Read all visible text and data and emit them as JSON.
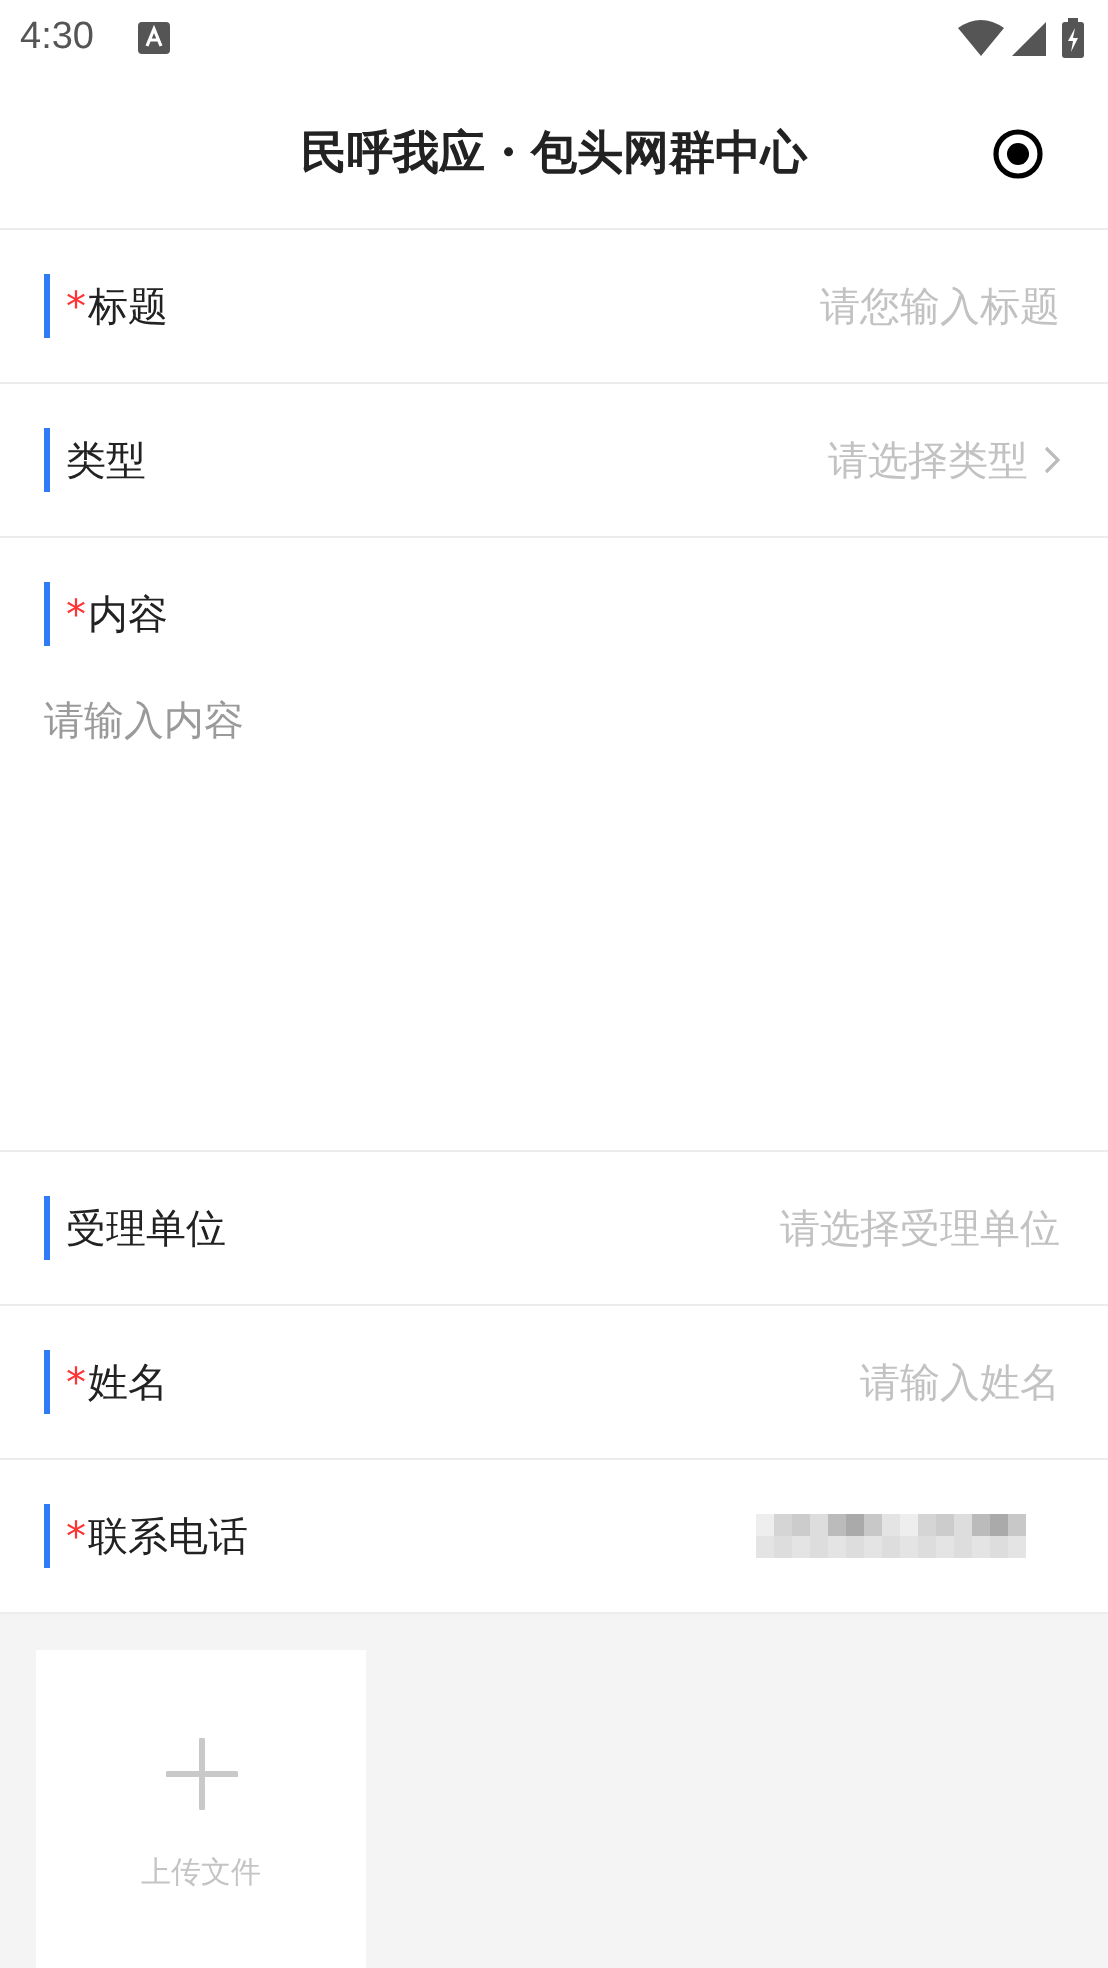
{
  "status_bar": {
    "time": "4:30"
  },
  "header": {
    "title": "民呼我应・包头网群中心"
  },
  "fields": [
    {
      "kind": "input",
      "required_mark": "*",
      "label": "标题",
      "placeholder": "请您输入标题"
    },
    {
      "kind": "select",
      "label": "类型",
      "placeholder": "请选择类型"
    },
    {
      "kind": "textarea",
      "required_mark": "*",
      "label": "内容",
      "placeholder": "请输入内容"
    },
    {
      "kind": "select_plain",
      "label": "受理单位",
      "placeholder": "请选择受理单位"
    },
    {
      "kind": "input",
      "required_mark": "*",
      "label": "姓名",
      "placeholder": "请输入姓名"
    },
    {
      "kind": "masked",
      "required_mark": "*",
      "label": "联系电话"
    }
  ],
  "upload": {
    "label": "上传文件"
  }
}
